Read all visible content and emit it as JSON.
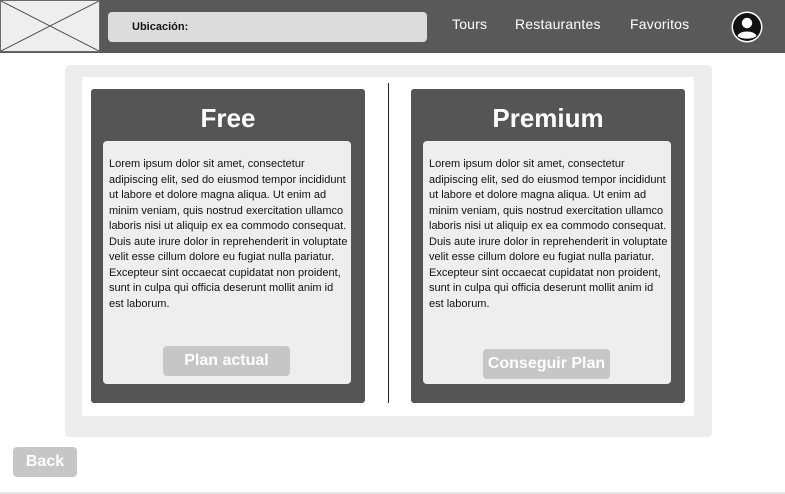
{
  "header": {
    "location_label": "Ubicación:",
    "nav": [
      "Tours",
      "Restaurantes",
      "Favoritos"
    ],
    "avatar_icon": "user-circle-icon",
    "logo_icon": "image-placeholder-icon"
  },
  "plans": [
    {
      "title": "Free",
      "description": "Lorem ipsum dolor sit amet, consectetur adipiscing elit, sed do eiusmod tempor incididunt ut labore et dolore magna aliqua. Ut enim ad minim veniam, quis nostrud exercitation ullamco laboris nisi ut aliquip ex ea commodo consequat. Duis aute irure dolor in reprehenderit in voluptate velit esse cillum dolore eu fugiat nulla pariatur. Excepteur sint occaecat cupidatat non proident, sunt in culpa qui officia deserunt mollit anim id est laborum.",
      "button": "Plan actual"
    },
    {
      "title": "Premium",
      "description": "Lorem ipsum dolor sit amet, consectetur adipiscing elit, sed do eiusmod tempor incididunt ut labore et dolore magna aliqua. Ut enim ad minim veniam, quis nostrud exercitation ullamco laboris nisi ut aliquip ex ea commodo consequat. Duis aute irure dolor in reprehenderit in voluptate velit esse cillum dolore eu fugiat nulla pariatur. Excepteur sint occaecat cupidatat non proident, sunt in culpa qui officia deserunt mollit anim id est laborum.",
      "button": "Conseguir Plan"
    }
  ],
  "back_label": "Back",
  "colors": {
    "header_bg": "#595959",
    "card_bg": "#555555",
    "button_bg": "#c6c6c6",
    "panel_bg": "#ececec"
  }
}
